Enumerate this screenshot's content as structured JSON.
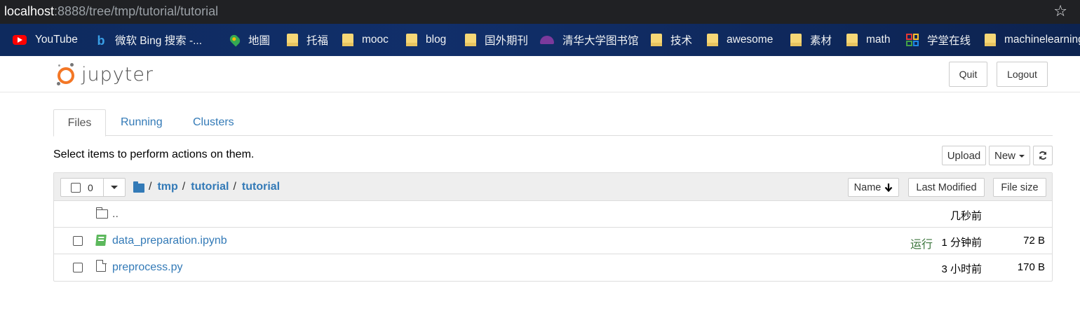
{
  "browser": {
    "url_host": "localhost",
    "url_path": ":8888/tree/tmp/tutorial/tutorial",
    "bookmarks": [
      {
        "label": "YouTube",
        "icon": "youtube-icon"
      },
      {
        "label": "微软 Bing 搜索 -...",
        "icon": "bing-icon"
      },
      {
        "label": "地圖",
        "icon": "maps-icon"
      },
      {
        "label": "托福",
        "icon": "folder-icon"
      },
      {
        "label": "mooc",
        "icon": "folder-icon"
      },
      {
        "label": "blog",
        "icon": "folder-icon"
      },
      {
        "label": "国外期刊",
        "icon": "folder-icon"
      },
      {
        "label": "清华大学图书馆",
        "icon": "library-icon"
      },
      {
        "label": "技术",
        "icon": "folder-icon"
      },
      {
        "label": "awesome",
        "icon": "folder-icon"
      },
      {
        "label": "素材",
        "icon": "folder-icon"
      },
      {
        "label": "math",
        "icon": "folder-icon"
      },
      {
        "label": "学堂在线",
        "icon": "xuetang-icon"
      },
      {
        "label": "machinelearning",
        "icon": "folder-icon"
      }
    ]
  },
  "header": {
    "logo_text": "jupyter",
    "quit_label": "Quit",
    "logout_label": "Logout"
  },
  "tabs": [
    {
      "label": "Files",
      "active": true
    },
    {
      "label": "Running",
      "active": false
    },
    {
      "label": "Clusters",
      "active": false
    }
  ],
  "toolbar": {
    "hint": "Select items to perform actions on them.",
    "upload_label": "Upload",
    "new_label": "New"
  },
  "list": {
    "selected_count": "0",
    "breadcrumb": [
      "tmp",
      "tutorial",
      "tutorial"
    ],
    "sort_name_label": "Name",
    "sort_modified_label": "Last Modified",
    "sort_size_label": "File size",
    "rows": [
      {
        "name": "..",
        "type": "parent-folder",
        "status": "",
        "modified": "几秒前",
        "size": ""
      },
      {
        "name": "data_preparation.ipynb",
        "type": "notebook",
        "status": "运行",
        "modified": "1 分钟前",
        "size": "72 B"
      },
      {
        "name": "preprocess.py",
        "type": "file",
        "status": "",
        "modified": "3 小时前",
        "size": "170 B"
      }
    ]
  },
  "colors": {
    "link": "#337ab7",
    "running": "#3c763d",
    "jupyter_orange": "#f37726"
  }
}
